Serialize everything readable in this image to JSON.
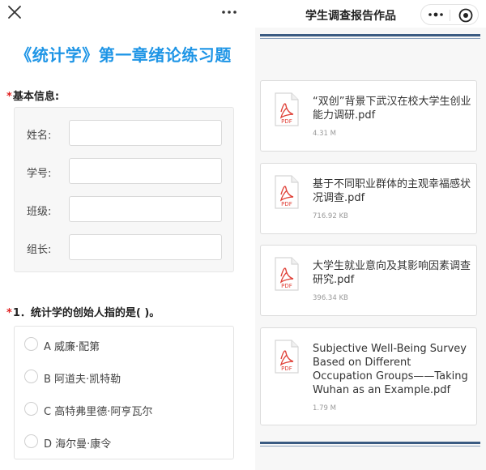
{
  "left_panel": {
    "top_bar": {
      "close_icon": "close-icon",
      "more_icon": "more-dots-icon"
    },
    "title": "《统计学》第一章绪论练习题",
    "basic_info": {
      "required_mark": "*",
      "heading": "基本信息:",
      "fields": [
        {
          "label": "姓名:",
          "value": ""
        },
        {
          "label": "学号:",
          "value": ""
        },
        {
          "label": "班级:",
          "value": ""
        },
        {
          "label": "组长:",
          "value": ""
        }
      ]
    },
    "question": {
      "required_mark": "*",
      "text": "1．统计学的创始人指的是( )。",
      "options": [
        {
          "label": "A 威廉·配第",
          "selected": false
        },
        {
          "label": "B 阿道夫·凯特勒",
          "selected": false
        },
        {
          "label": "C 高特弗里德·阿亨瓦尔",
          "selected": false
        },
        {
          "label": "D 海尔曼·康令",
          "selected": false
        }
      ]
    }
  },
  "right_panel": {
    "title": "学生调查报告作品",
    "capsule": {
      "more_icon": "more-dots-icon",
      "target_icon": "target-icon"
    },
    "files": [
      {
        "name": "“双创”背景下武汉在校大学生创业能力调研.pdf",
        "size": "4.31 M",
        "icon": "pdf-file-icon"
      },
      {
        "name": "基于不同职业群体的主观幸福感状况调查.pdf",
        "size": "716.92 KB",
        "icon": "pdf-file-icon"
      },
      {
        "name": "大学生就业意向及其影响因素调查研究.pdf",
        "size": "396.34 KB",
        "icon": "pdf-file-icon"
      },
      {
        "name": "Subjective Well-Being Survey Based on Different Occupation Groups——Taking Wuhan as an Example.pdf",
        "size": "1.79 M",
        "icon": "pdf-file-icon"
      }
    ],
    "pdf_badge": "PDF"
  },
  "colors": {
    "title_blue": "#1e95e6",
    "required_red": "#e02020",
    "rule_navy": "#3b5b82",
    "pdf_red": "#e0433a"
  }
}
